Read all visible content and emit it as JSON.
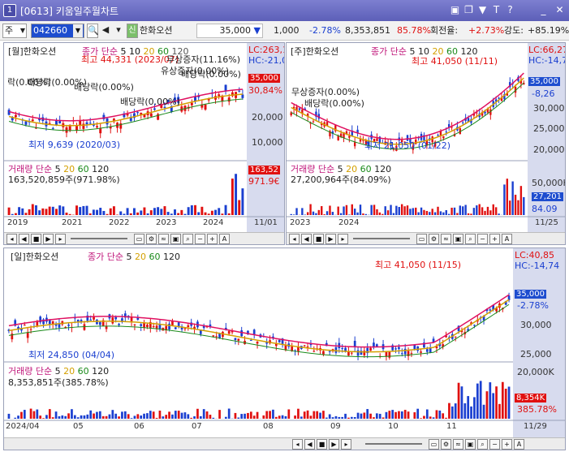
{
  "window": {
    "badge": "1",
    "title": "[0613] 키움일주월차트"
  },
  "toolbar": {
    "period": "주",
    "code": "042660",
    "stock_name": "한화오션",
    "price": "35,000",
    "change": "1,000",
    "change_pct": "-2.78%",
    "volume": "8,353,851",
    "volume_ratio": "85.78%",
    "turnover_label": "회전율:",
    "turnover": "+2.73%",
    "strength_label": "강도:",
    "strength": "+85.19%",
    "colors": {
      "down": "#1a3fd0",
      "up": "#e01010",
      "highlight": "#c8e0ff"
    }
  },
  "monthly": {
    "title": "[월]한화오션",
    "legend": [
      "종가 단순",
      "5",
      "10",
      "20",
      "60",
      "120"
    ],
    "lc": "LC:263,1",
    "hc": "HC:-21,0",
    "price_tag": "35,000",
    "pct_tag": "30,84%",
    "y_ticks": [
      "20,000",
      "10,000"
    ],
    "high_label": "최고 44,331 (2023/07)",
    "low_label": "최저 9,639 (2020/03)",
    "events": [
      "락(0.00%)",
      "배당락(0.00%)",
      "배당락(0.00%)",
      "배당락(0.00%)",
      "유상증자(0.00%)",
      "무상증자(11.16%)",
      "배당락(0.00%)"
    ],
    "volume_title": "거래량",
    "volume_legend": [
      "단순",
      "5",
      "20",
      "60",
      "120"
    ],
    "volume_value": "163,520,859주(971.98%)",
    "vol_tag": "163,52",
    "vol_pct_tag": "971.9€",
    "x_labels": [
      "2019",
      "2021",
      "2022",
      "2023",
      "2024",
      "11/01"
    ]
  },
  "weekly": {
    "title": "[주]한화오션",
    "legend": [
      "종가 단순",
      "5",
      "10",
      "20",
      "60",
      "120"
    ],
    "lc": "LC:66,27",
    "hc": "HC:-14,7",
    "price_tag": "35,000",
    "pct_tag": "-8,26",
    "y_ticks": [
      "30,000",
      "25,000",
      "20,000"
    ],
    "high_label": "최고 41,050 (11/11)",
    "low_label": "최저 21,050 (01/22)",
    "events": [
      "무상증자(0.00%)",
      "배당락(0.00%)"
    ],
    "volume_title": "거래량",
    "volume_legend": [
      "단순",
      "5",
      "20",
      "60",
      "120"
    ],
    "volume_value": "27,200,964주(84.09%)",
    "vol_y": "50,000K",
    "vol_tag": "27,201",
    "vol_pct_tag": "84.09",
    "x_labels": [
      "2023",
      "2024",
      "11/25"
    ]
  },
  "daily": {
    "title": "[일]한화오션",
    "legend": [
      "종가 단순",
      "5",
      "20",
      "60",
      "120"
    ],
    "lc": "LC:40,85",
    "hc": "HC:-14,74",
    "price_tag": "35,000",
    "pct_tag": "-2.78%",
    "y_ticks": [
      "30,000",
      "25,000"
    ],
    "high_label": "최고 41,050 (11/15)",
    "low_label": "최저 24,850 (04/04)",
    "volume_title": "거래량",
    "volume_legend": [
      "단순",
      "5",
      "20",
      "60",
      "120"
    ],
    "volume_value": "8,353,851주(385.78%)",
    "vol_y": "20,000K",
    "vol_tag": "8,354K",
    "vol_pct_tag": "385.78%",
    "x_labels": [
      "2024/04",
      "05",
      "06",
      "07",
      "08",
      "09",
      "10",
      "11",
      "11/29"
    ]
  },
  "icons": {
    "titlebar": [
      "window-icon",
      "restore-icon",
      "pin-icon",
      "text-icon",
      "help-icon",
      "minimize-icon",
      "close-icon"
    ]
  }
}
